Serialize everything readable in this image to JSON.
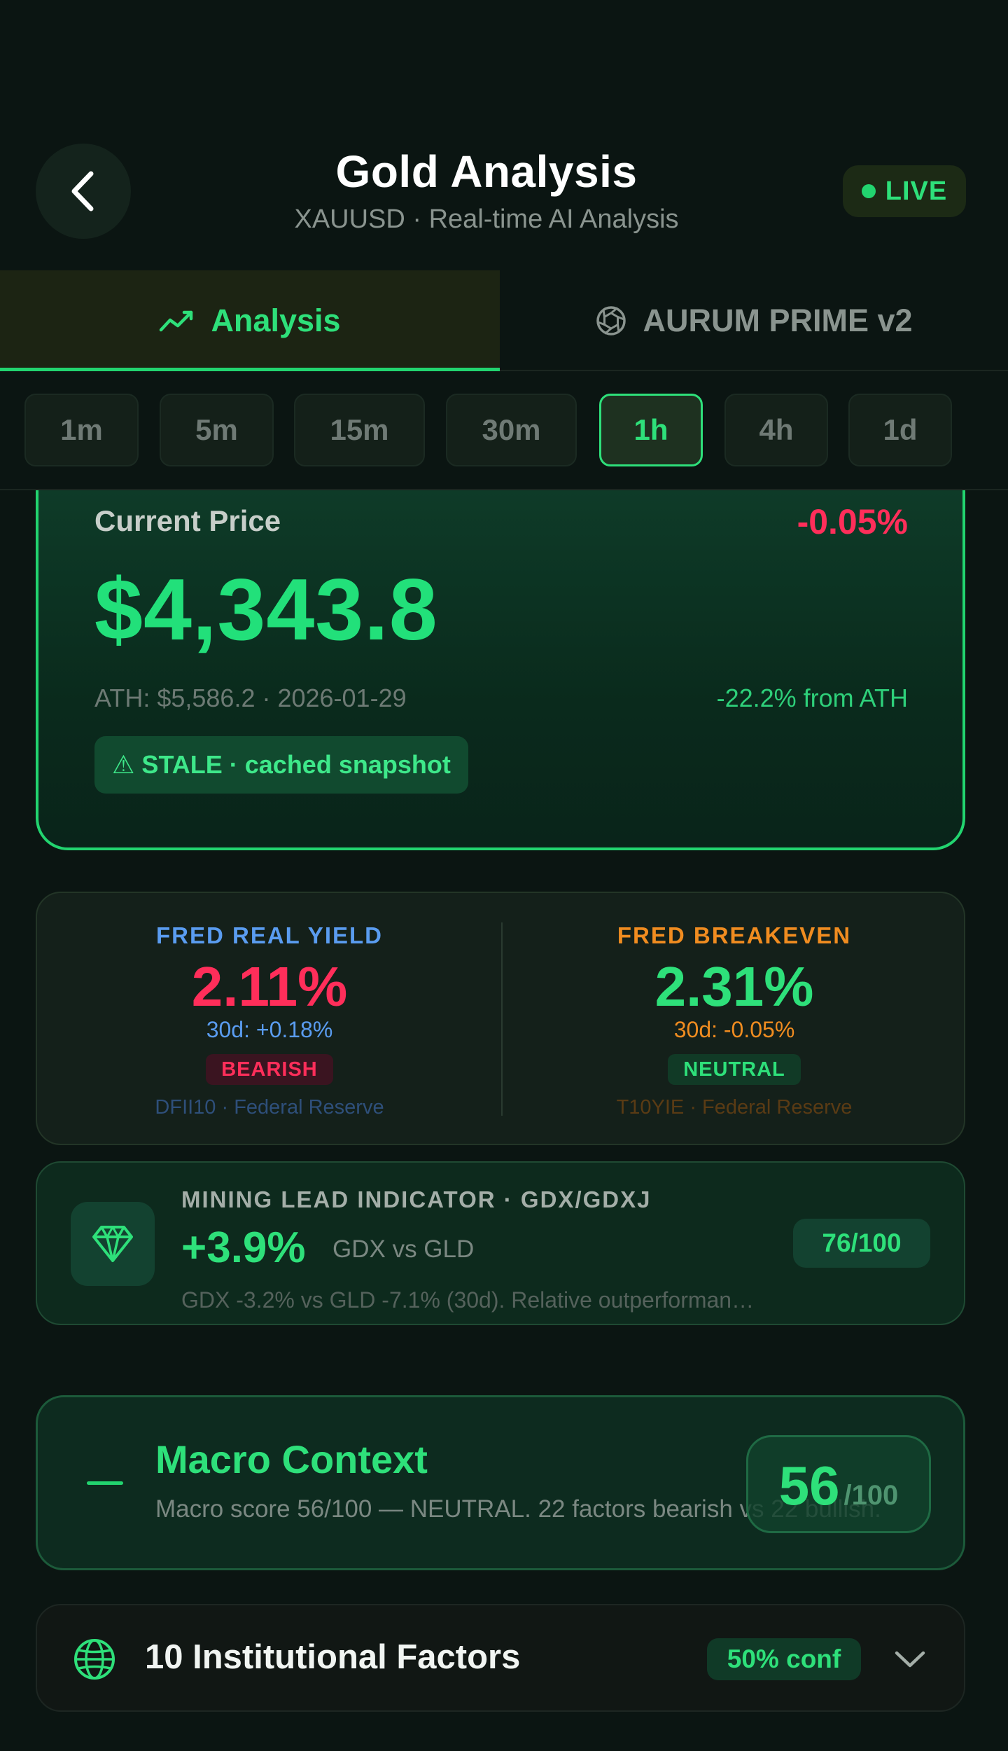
{
  "header": {
    "title": "Gold Analysis",
    "subtitle": "XAUUSD · Real-time AI Analysis",
    "live_label": "LIVE",
    "back_icon": "chevron-left-icon"
  },
  "tabs": [
    {
      "label": "Analysis",
      "icon": "trend-line-icon",
      "active": true
    },
    {
      "label": "AURUM PRIME v2",
      "icon": "aperture-icon",
      "active": false
    }
  ],
  "timeframes": [
    {
      "label": "1m",
      "active": false
    },
    {
      "label": "5m",
      "active": false
    },
    {
      "label": "15m",
      "active": false
    },
    {
      "label": "30m",
      "active": false
    },
    {
      "label": "1h",
      "active": true
    },
    {
      "label": "4h",
      "active": false
    },
    {
      "label": "1d",
      "active": false
    }
  ],
  "price_card": {
    "label": "Current Price",
    "change": "-0.05%",
    "price": "$4,343.8",
    "ath": "ATH: $5,586.2 · 2026-01-29",
    "from_ath": "-22.2% from ATH",
    "stale_label": "⚠ STALE · cached snapshot"
  },
  "fred": {
    "real_yield": {
      "title": "FRED REAL YIELD",
      "value": "2.11%",
      "change_30d": "30d: +0.18%",
      "badge": "BEARISH",
      "source": "DFII10 · Federal Reserve"
    },
    "breakeven": {
      "title": "FRED BREAKEVEN",
      "value": "2.31%",
      "change_30d": "30d: -0.05%",
      "badge": "NEUTRAL",
      "source": "T10YIE · Federal Reserve"
    }
  },
  "mining": {
    "title": "MINING LEAD INDICATOR · GDX/GDXJ",
    "value": "+3.9%",
    "vs_label": "GDX vs GLD",
    "description": "GDX -3.2% vs GLD -7.1% (30d). Relative outperforman…",
    "score": "76/100",
    "icon": "diamond-icon"
  },
  "macro": {
    "title": "Macro Context",
    "description": "Macro score 56/100 — NEUTRAL. 22 factors bearish vs 22 bullish.",
    "score": "56",
    "score_max": "/100"
  },
  "factors": {
    "title": "10 Institutional Factors",
    "confidence": "50% conf",
    "icon": "globe-icon",
    "expand_icon": "chevron-down-icon"
  },
  "colors": {
    "accent_green": "#22d46f",
    "negative_red": "#ff2e5a",
    "real_yield_blue": "#5a9cf0",
    "breakeven_orange": "#f08c20",
    "background": "#0b1512"
  }
}
